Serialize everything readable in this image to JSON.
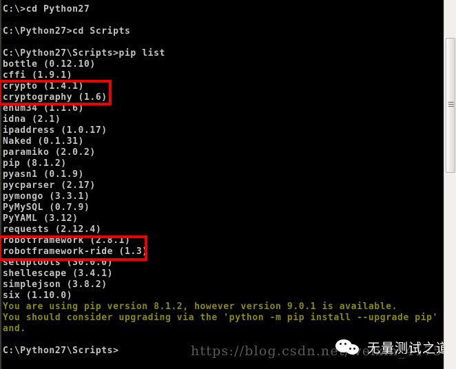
{
  "console": {
    "background_color": "#000000",
    "text_color": "#c4c4c4",
    "warning_color": "#8a8a10",
    "lines": [
      {
        "text": "C:\\>cd Python27",
        "kind": "normal"
      },
      {
        "text": "",
        "kind": "blank"
      },
      {
        "text": "C:\\Python27>cd Scripts",
        "kind": "normal"
      },
      {
        "text": "",
        "kind": "blank"
      },
      {
        "text": "C:\\Python27\\Scripts>pip list",
        "kind": "normal"
      },
      {
        "text": "bottle (0.12.10)",
        "kind": "normal"
      },
      {
        "text": "cffi (1.9.1)",
        "kind": "normal"
      },
      {
        "text": "crypto (1.4.1)",
        "kind": "normal"
      },
      {
        "text": "cryptography (1.6)",
        "kind": "normal"
      },
      {
        "text": "enum34 (1.1.6)",
        "kind": "normal"
      },
      {
        "text": "idna (2.1)",
        "kind": "normal"
      },
      {
        "text": "ipaddress (1.0.17)",
        "kind": "normal"
      },
      {
        "text": "Naked (0.1.31)",
        "kind": "normal"
      },
      {
        "text": "paramiko (2.0.2)",
        "kind": "normal"
      },
      {
        "text": "pip (8.1.2)",
        "kind": "normal"
      },
      {
        "text": "pyasn1 (0.1.9)",
        "kind": "normal"
      },
      {
        "text": "pycparser (2.17)",
        "kind": "normal"
      },
      {
        "text": "pymongo (3.3.1)",
        "kind": "normal"
      },
      {
        "text": "PyMySQL (0.7.9)",
        "kind": "normal"
      },
      {
        "text": "PyYAML (3.12)",
        "kind": "normal"
      },
      {
        "text": "requests (2.12.4)",
        "kind": "normal"
      },
      {
        "text": "robotframework (2.8.1)",
        "kind": "normal"
      },
      {
        "text": "robotframework-ride (1.3)",
        "kind": "normal"
      },
      {
        "text": "setuptools (30.0.0)",
        "kind": "normal"
      },
      {
        "text": "shellescape (3.4.1)",
        "kind": "normal"
      },
      {
        "text": "simplejson (3.8.2)",
        "kind": "normal"
      },
      {
        "text": "six (1.10.0)",
        "kind": "normal"
      },
      {
        "text": "You are using pip version 8.1.2, however version 9.0.1 is available.",
        "kind": "warn"
      },
      {
        "text": "You should consider upgrading via the 'python -m pip install --upgrade pip' comm",
        "kind": "warn"
      },
      {
        "text": "and.",
        "kind": "warn"
      },
      {
        "text": "",
        "kind": "blank"
      },
      {
        "text": "C:\\Python27\\Scripts>",
        "kind": "normal"
      }
    ]
  },
  "annotations": {
    "color": "#ee0000",
    "boxes": [
      {
        "id": "crypto-highlight",
        "label": "crypto / cryptography highlight"
      },
      {
        "id": "robotframework-highlight",
        "label": "robotframework / robotframework-ride highlight"
      }
    ]
  },
  "scrollbar": {
    "orientation": "vertical",
    "track_color": "#f1f0ee",
    "thumb_color": "#ececea"
  },
  "watermarks": {
    "url": "https://blog.csdn.net/weixin_41754309",
    "wechat_name": "无量测试之道",
    "wechat_icon": "wechat-icon"
  }
}
